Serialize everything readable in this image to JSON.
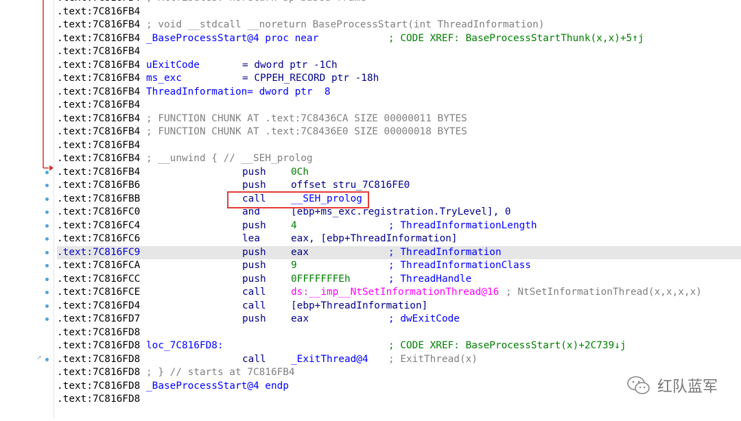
{
  "colors": {
    "label": "#0000ff",
    "comment": "#808080",
    "mnemonic": "#00008b",
    "highlight": "#e6e6e6",
    "box": "#e53935",
    "arrow": "#d32f2f",
    "dot": "#4fa3dc"
  },
  "watermark": {
    "icon": "wechat-icon",
    "text": "红队蓝军"
  },
  "lines": [
    {
      "addr": ".text:7C816FB4",
      "cmt": "; Attributes: noreturn bp-based frame"
    },
    {
      "addr": ".text:7C816FB4"
    },
    {
      "addr": ".text:7C816FB4",
      "cmt": "; void __stdcall __noreturn BaseProcessStart(int ThreadInformation)"
    },
    {
      "addr": ".text:7C816FB4",
      "lab": "_BaseProcessStart@4 proc near",
      "rc": "; CODE XREF: BaseProcessStartThunk(x,x)+5↑j"
    },
    {
      "addr": ".text:7C816FB4"
    },
    {
      "addr": ".text:7C816FB4",
      "lab": "uExitCode",
      "mn": "= dword ptr -1Ch"
    },
    {
      "addr": ".text:7C816FB4",
      "lab": "ms_exc",
      "mn": "= CPPEH_RECORD ptr -18h"
    },
    {
      "addr": ".text:7C816FB4",
      "lab": "ThreadInformation= dword ptr  8"
    },
    {
      "addr": ".text:7C816FB4"
    },
    {
      "addr": ".text:7C816FB4",
      "cmt": "; FUNCTION CHUNK AT .text:7C8436CA SIZE 00000011 BYTES"
    },
    {
      "addr": ".text:7C816FB4",
      "cmt": "; FUNCTION CHUNK AT .text:7C8436E0 SIZE 00000018 BYTES"
    },
    {
      "addr": ".text:7C816FB4"
    },
    {
      "addr": ".text:7C816FB4",
      "cmt": "; __unwind { // __SEH_prolog"
    },
    {
      "addr": ".text:7C816FB4",
      "mn": "push",
      "op": "0Ch"
    },
    {
      "addr": ".text:7C816FB6",
      "mn": "push",
      "op": "offset stru_7C816FE0"
    },
    {
      "addr": ".text:7C816FBB",
      "mn": "call",
      "op": "__SEH_prolog"
    },
    {
      "addr": ".text:7C816FC0",
      "mn": "and",
      "op": "[ebp+ms_exc.registration.TryLevel], 0"
    },
    {
      "addr": ".text:7C816FC4",
      "mn": "push",
      "op": "4",
      "rc": "; ThreadInformationLength"
    },
    {
      "addr": ".text:7C816FC6",
      "mn": "lea",
      "op": "eax, [ebp+ThreadInformation]"
    },
    {
      "addr": ".text:7C816FC9",
      "mn": "push",
      "op": "eax",
      "rc": "; ThreadInformation"
    },
    {
      "addr": ".text:7C816FCA",
      "mn": "push",
      "op": "9",
      "rc": "; ThreadInformationClass"
    },
    {
      "addr": ".text:7C816FCC",
      "mn": "push",
      "op": "0FFFFFFFEh",
      "rc": "; ThreadHandle"
    },
    {
      "addr": ".text:7C816FCE",
      "mn": "call",
      "op": "ds:__imp__NtSetInformationThread@16",
      "rc": "; NtSetInformationThread(x,x,x,x)"
    },
    {
      "addr": ".text:7C816FD4",
      "mn": "call",
      "op": "[ebp+ThreadInformation]"
    },
    {
      "addr": ".text:7C816FD7",
      "mn": "push",
      "op": "eax",
      "rc": "; dwExitCode"
    },
    {
      "addr": ".text:7C816FD8"
    },
    {
      "addr": ".text:7C816FD8",
      "lab": "loc_7C816FD8:",
      "rc": "; CODE XREF: BaseProcessStart(x)+2C739↓j"
    },
    {
      "addr": ".text:7C816FD8",
      "mn": "call",
      "op": "_ExitThread@4",
      "rc": "; ExitThread(x)"
    },
    {
      "addr": ".text:7C816FD8",
      "cmt": "; } // starts at 7C816FB4"
    },
    {
      "addr": ".text:7C816FD8",
      "lab": "_BaseProcessStart@4 endp"
    },
    {
      "addr": ".text:7C816FD8"
    }
  ]
}
